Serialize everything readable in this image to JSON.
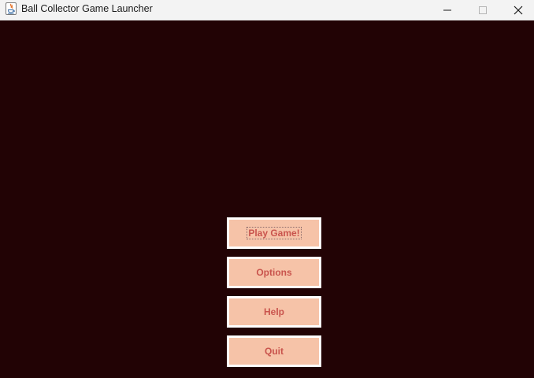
{
  "window": {
    "title": "Ball Collector Game Launcher",
    "app_icon": "java-icon",
    "controls": {
      "minimize_icon": "minimize-icon",
      "maximize_icon": "maximize-icon",
      "close_icon": "close-icon"
    }
  },
  "menu": {
    "items": [
      {
        "label": "Play Game!",
        "focused": true
      },
      {
        "label": "Options",
        "focused": false
      },
      {
        "label": "Help",
        "focused": false
      },
      {
        "label": "Quit",
        "focused": false
      }
    ]
  },
  "colors": {
    "background": "#220305",
    "button_fill": "#f6c3a8",
    "button_border": "#ffffff",
    "button_text": "#c9544d"
  }
}
